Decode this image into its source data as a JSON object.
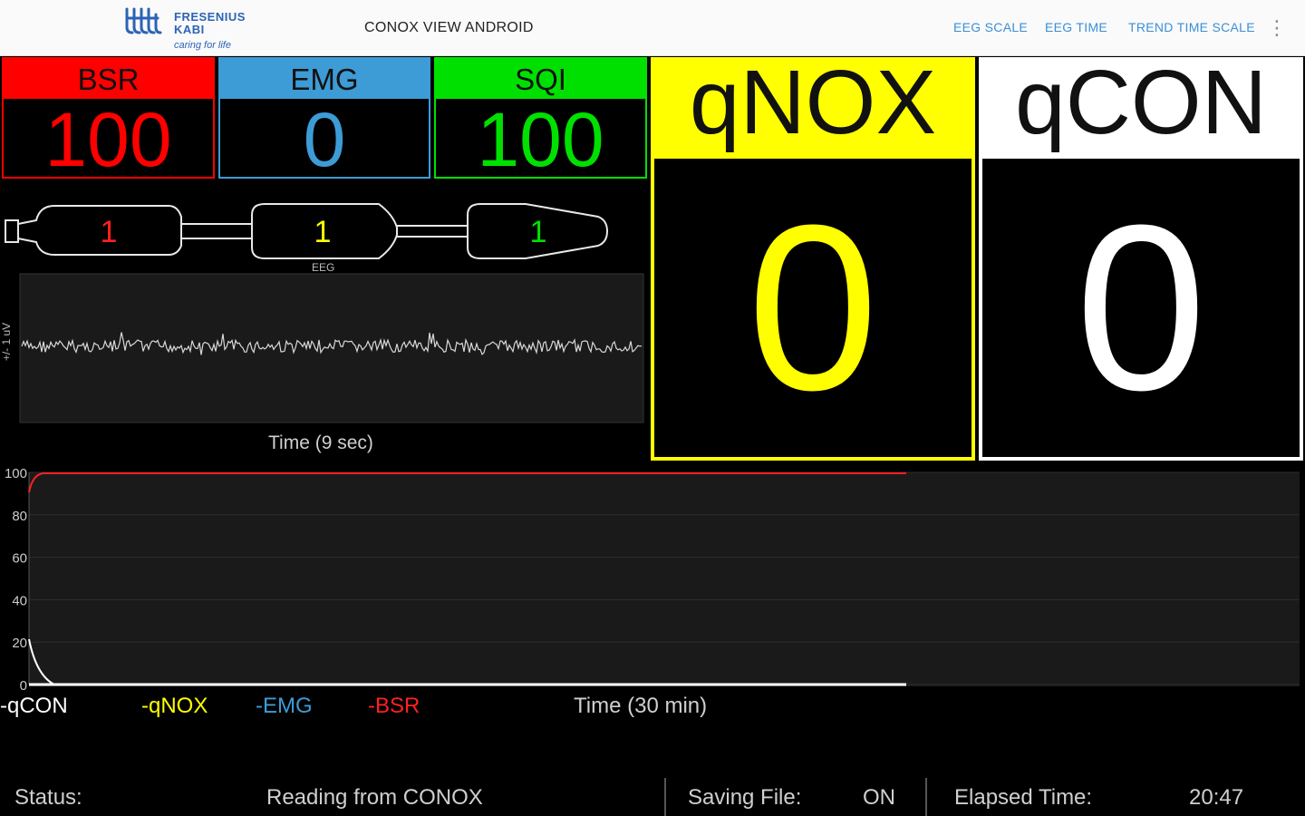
{
  "app": {
    "brand_name_line1": "FRESENIUS",
    "brand_name_line2": "KABI",
    "brand_tagline": "caring for life",
    "title": "CONOX VIEW ANDROID",
    "menu": {
      "eeg_scale": "EEG SCALE",
      "eeg_time": "EEG TIME",
      "trend_time_scale": "TREND TIME SCALE"
    },
    "overflow_icon": "more-vert-icon"
  },
  "tiles": {
    "bsr": {
      "label": "BSR",
      "value": "100",
      "color": "#ff0000"
    },
    "emg": {
      "label": "EMG",
      "value": "0",
      "color": "#3d9bd6"
    },
    "sqi": {
      "label": "SQI",
      "value": "100",
      "color": "#00e000"
    }
  },
  "panels": {
    "qnox": {
      "label": "qNOX",
      "value": "0",
      "color": "#ffff00"
    },
    "qcon": {
      "label": "qCON",
      "value": "0",
      "color": "#ffffff"
    }
  },
  "electrodes": {
    "values": [
      "1",
      "1",
      "1"
    ],
    "colors": [
      "#ff2020",
      "#ffff00",
      "#00e000"
    ],
    "label": "EEG"
  },
  "eeg": {
    "y_label": "+/- 1 uV",
    "x_label": "Time (9 sec)"
  },
  "trend": {
    "y_ticks": [
      "100",
      "80",
      "60",
      "40",
      "20",
      "0"
    ],
    "x_label": "Time (30 min)",
    "legend": [
      {
        "label": "-qCON",
        "color": "#ffffff"
      },
      {
        "label": "-qNOX",
        "color": "#ffff00"
      },
      {
        "label": "-EMG",
        "color": "#3d9bd6"
      },
      {
        "label": "-BSR",
        "color": "#ff2020"
      }
    ]
  },
  "status": {
    "status_label": "Status:",
    "status_value": "Reading from CONOX",
    "saving_label": "Saving File:",
    "saving_value": "ON",
    "elapsed_label": "Elapsed Time:",
    "elapsed_value": "20:47"
  }
}
